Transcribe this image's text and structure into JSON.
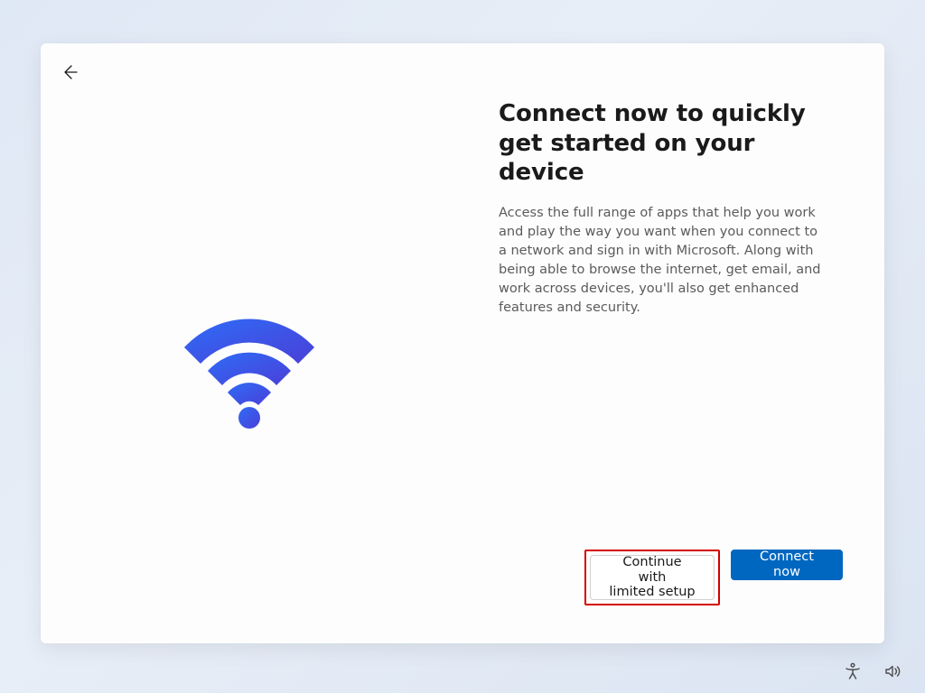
{
  "header": {
    "title": "Connect now to quickly get started on your device",
    "description": "Access the full range of apps that help you work and play the way you want when you connect to a network and sign in with Microsoft. Along with being able to browse the internet, get email, and work across devices, you'll also get enhanced features and security."
  },
  "actions": {
    "secondary_label": "Continue with\nlimited setup",
    "primary_label": "Connect now"
  }
}
